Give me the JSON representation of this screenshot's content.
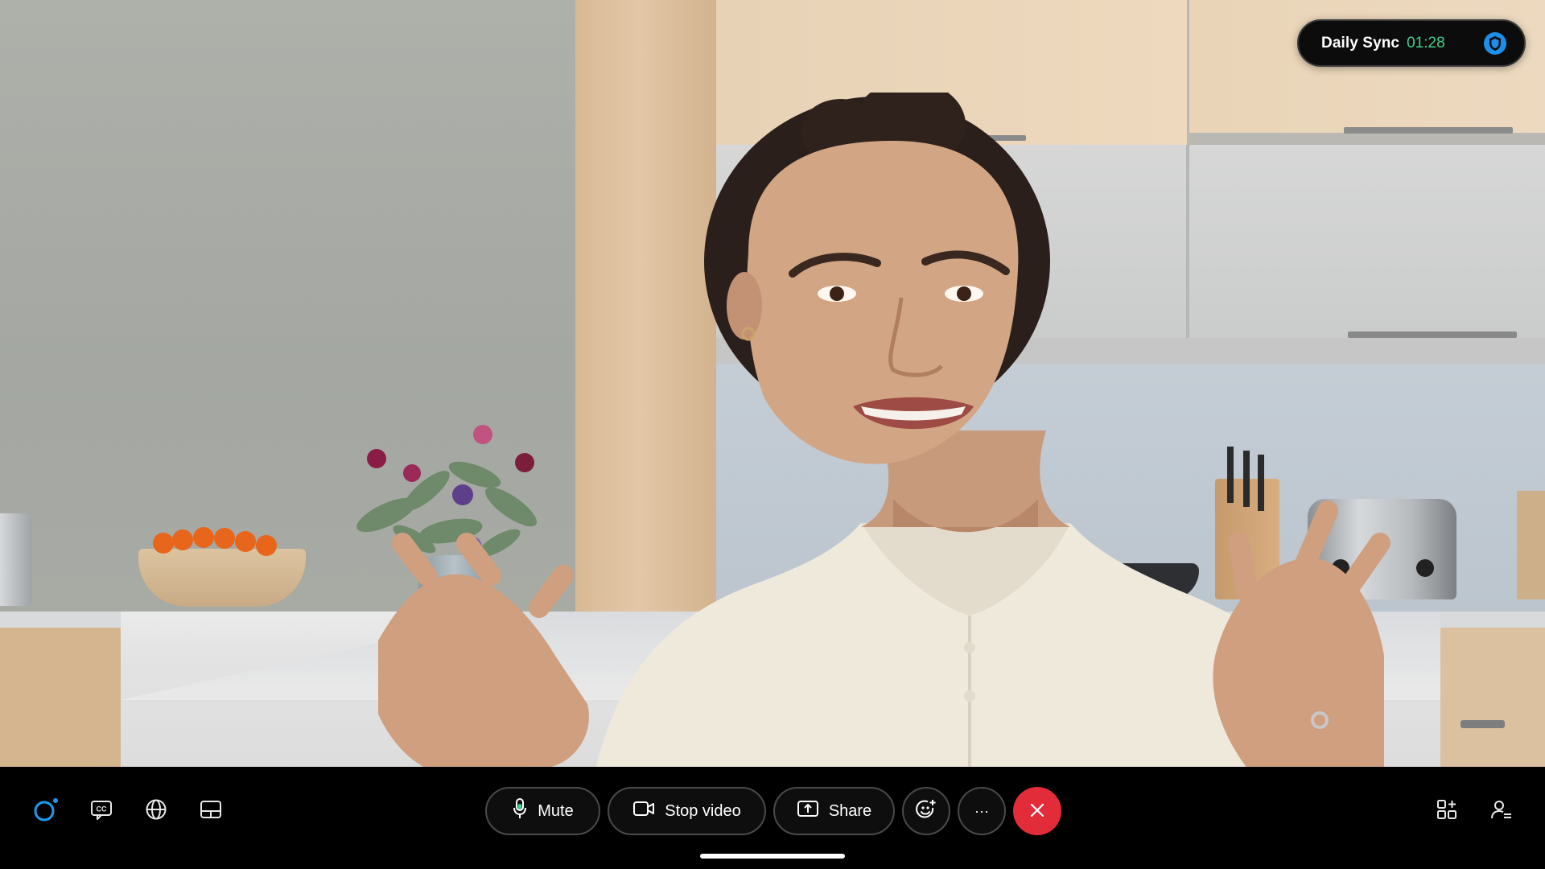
{
  "meeting": {
    "title": "Daily Sync",
    "timer": "01:28",
    "timer_color": "#3fcf8e",
    "security_icon": "shield-icon"
  },
  "video": {
    "description_icon": "participant-video-feed"
  },
  "left_tools": [
    {
      "name": "webex-assistant-icon",
      "label": "AI Assistant"
    },
    {
      "name": "closed-captions-icon",
      "label": "CC"
    },
    {
      "name": "language-globe-icon",
      "label": "Language"
    },
    {
      "name": "layout-icon",
      "label": "Layout"
    }
  ],
  "controls": {
    "mute_label": "Mute",
    "mute_icon": "microphone-icon",
    "stop_video_label": "Stop video",
    "stop_video_icon": "video-camera-icon",
    "share_label": "Share",
    "share_icon": "share-screen-icon",
    "reactions_icon": "reactions-smiley-icon",
    "more_label": "···",
    "end_call_icon": "close-icon",
    "end_call_color": "#e32c3a"
  },
  "right_tools": [
    {
      "name": "apps-icon"
    },
    {
      "name": "participants-icon"
    }
  ],
  "colors": {
    "bar_background": "#000000",
    "accent_blue": "#1d8fea"
  }
}
